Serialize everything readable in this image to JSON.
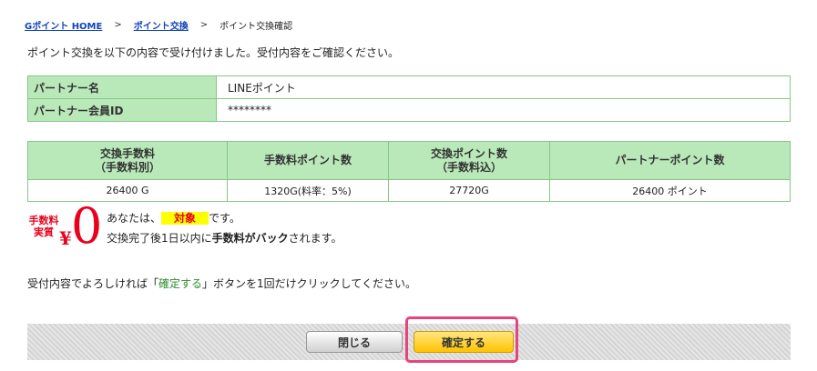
{
  "breadcrumb": {
    "home": "Gポイント HOME",
    "exchange": "ポイント交換",
    "current": "ポイント交換確認",
    "separator": ">"
  },
  "intro": "ポイント交換を以下の内容で受け付けました。受付内容をご確認ください。",
  "partner_info": {
    "partner_name_label": "パートナー名",
    "partner_name_value": "LINEポイント",
    "member_id_label": "パートナー会員ID",
    "member_id_value": "********"
  },
  "fee_table": {
    "headers": {
      "fee": [
        "交換手数料",
        "（手数料別）"
      ],
      "fee_points": "手数料ポイント数",
      "exchange_points": [
        "交換ポイント数",
        "（手数料込）"
      ],
      "partner_points": "パートナーポイント数"
    },
    "row": {
      "fee": "26400 G",
      "fee_points": "1320G(料率：5%)",
      "exchange_points": "27720G",
      "partner_points": "26400 ポイント"
    }
  },
  "badge": {
    "label_line1": "手数料",
    "label_line2": "実質",
    "yen": "¥",
    "zero": "0"
  },
  "notice": {
    "line1_prefix": "あなたは、",
    "line1_highlight": "対象",
    "line1_suffix": "です。",
    "line2_prefix": "交換完了後1日以内に",
    "line2_bold": "手数料がバック",
    "line2_suffix": "されます。"
  },
  "confirm_instruction": {
    "prefix": "受付内容でよろしければ「",
    "button_ref": "確定する",
    "suffix": "」ボタンを1回だけクリックしてください。"
  },
  "buttons": {
    "close": "閉じる",
    "confirm": "確定する"
  },
  "colors": {
    "header_green": "#b9e9b9",
    "border_green": "#86c786",
    "accent_red": "#e8001c",
    "highlight_yellow": "#ffff00",
    "confirm_button": "#ffc400",
    "focus_ring": "#e6447f"
  }
}
